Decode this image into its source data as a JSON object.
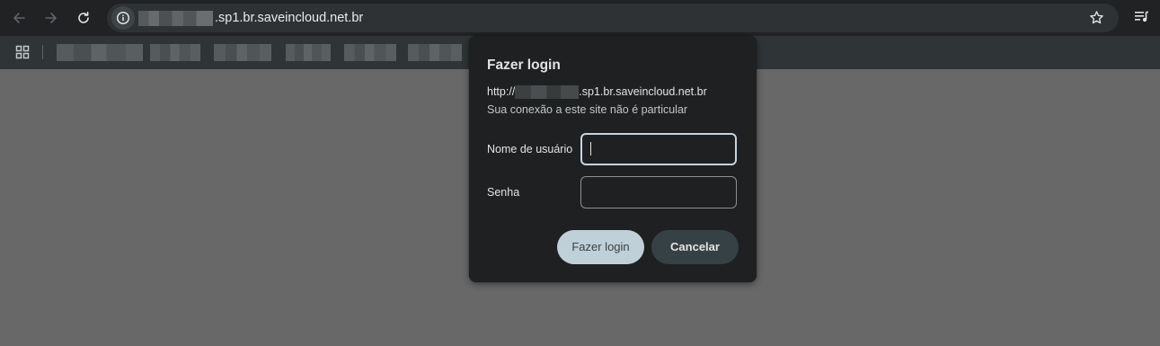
{
  "browser": {
    "url_suffix": ".sp1.br.saveincloud.net.br",
    "icons": {
      "back": "back-arrow-icon",
      "forward": "forward-arrow-icon",
      "reload": "reload-icon",
      "site_info": "info-icon",
      "bookmark": "star-icon",
      "reading_list": "reading-list-icon",
      "apps": "apps-grid-icon"
    }
  },
  "dialog": {
    "title": "Fazer login",
    "origin_prefix": "http://",
    "origin_suffix": ".sp1.br.saveincloud.net.br",
    "privacy_note": "Sua conexão a este site não é particular",
    "username_label": "Nome de usuário",
    "username_value": "",
    "password_label": "Senha",
    "password_value": "",
    "login_button": "Fazer login",
    "cancel_button": "Cancelar"
  },
  "colors": {
    "page_background": "#686868",
    "toolbar": "#202223",
    "dialog_background": "#1f2021",
    "primary_button": "#bfd0d8",
    "secondary_button": "#364145"
  }
}
